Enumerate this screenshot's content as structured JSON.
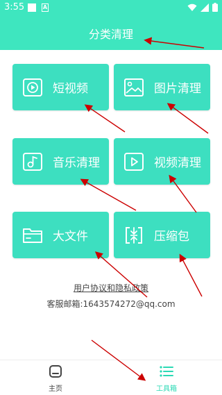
{
  "status_bar": {
    "time": "3:55",
    "icons": [
      "notification-square-icon",
      "a-badge-icon",
      "wifi-icon",
      "signal-icon",
      "battery-icon"
    ]
  },
  "header": {
    "title": "分类清理"
  },
  "cards": [
    {
      "label": "短视频",
      "icon": "video-circle-icon"
    },
    {
      "label": "图片清理",
      "icon": "image-icon"
    },
    {
      "label": "音乐清理",
      "icon": "music-note-icon"
    },
    {
      "label": "视频清理",
      "icon": "play-icon"
    },
    {
      "label": "大文件",
      "icon": "folder-icon"
    },
    {
      "label": "压缩包",
      "icon": "compress-icon"
    }
  ],
  "links": {
    "agreement": "用户协议和隐私政策",
    "service": "客服邮箱:1643574272@qq.com"
  },
  "tabbar": {
    "items": [
      {
        "label": "主页",
        "icon": "home-icon",
        "active": false
      },
      {
        "label": "工具箱",
        "icon": "menu-list-icon",
        "active": true
      }
    ]
  },
  "colors": {
    "accent": "#3ee6bf",
    "card": "#3ddfc0",
    "active_tab": "#2ad9b4",
    "annotation_arrow": "#cc0000"
  }
}
